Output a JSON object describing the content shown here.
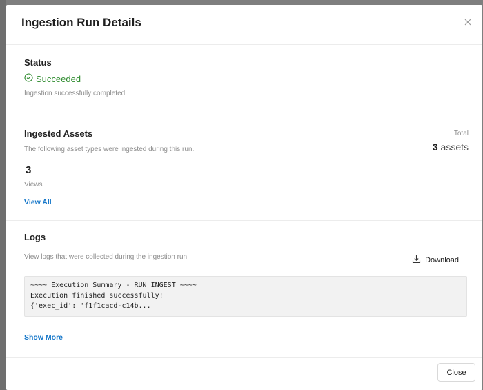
{
  "modal": {
    "title": "Ingestion Run Details"
  },
  "status": {
    "heading": "Status",
    "state": "Succeeded",
    "message": "Ingestion successfully completed",
    "state_color": "#2e8b2e"
  },
  "assets": {
    "heading": "Ingested Assets",
    "description": "The following asset types were ingested during this run.",
    "total_label": "Total",
    "total_count": "3",
    "total_unit": "assets",
    "type_count": "3",
    "type_name": "Views",
    "view_all_label": "View All"
  },
  "logs": {
    "heading": "Logs",
    "description": "View logs that were collected during the ingestion run.",
    "download_label": "Download",
    "lines": [
      "~~~~ Execution Summary - RUN_INGEST ~~~~",
      "Execution finished successfully!",
      "{'exec_id': 'f1f1cacd-c14b..."
    ],
    "show_more_label": "Show More"
  },
  "footer": {
    "close_label": "Close"
  },
  "colors": {
    "link": "#1677c9",
    "success": "#2e8b2e"
  }
}
